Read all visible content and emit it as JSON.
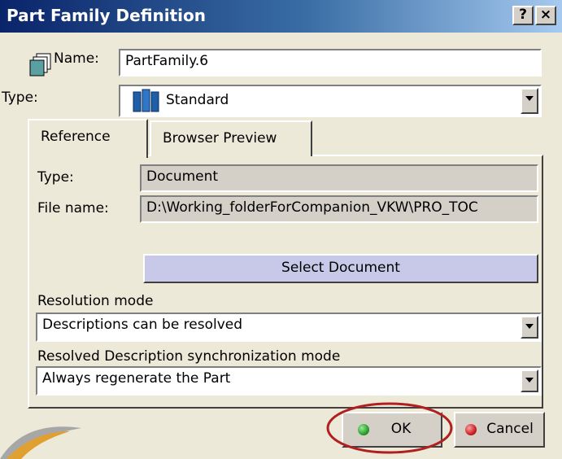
{
  "window": {
    "title": "Part Family Definition",
    "help_label": "?",
    "close_label": "×"
  },
  "form": {
    "name_label": "Name:",
    "name_value": "PartFamily.6",
    "type_label": "Type:",
    "type_value": "Standard"
  },
  "tabs": [
    {
      "label": "Reference"
    },
    {
      "label": "Browser Preview"
    }
  ],
  "reference": {
    "type_label": "Type:",
    "type_value": "Document",
    "file_label": "File name:",
    "file_value": "D:\\Working_folderForCompanion_VKW\\PRO_TOC",
    "select_button": "Select Document",
    "resolution_label": "Resolution mode",
    "resolution_value": "Descriptions can be resolved",
    "sync_label": "Resolved Description synchronization mode",
    "sync_value": "Always regenerate the Part"
  },
  "buttons": {
    "ok": "OK",
    "cancel": "Cancel"
  },
  "colors": {
    "title_start": "#0a246a",
    "title_end": "#a6caf0",
    "ok_dot": "#2aa02a",
    "cancel_dot": "#d02020",
    "highlight_ring": "#b02020"
  },
  "icons": {
    "name": "document-stack-icon",
    "type": "books-icon",
    "ok": "green-dot-icon",
    "cancel": "red-dot-icon"
  }
}
